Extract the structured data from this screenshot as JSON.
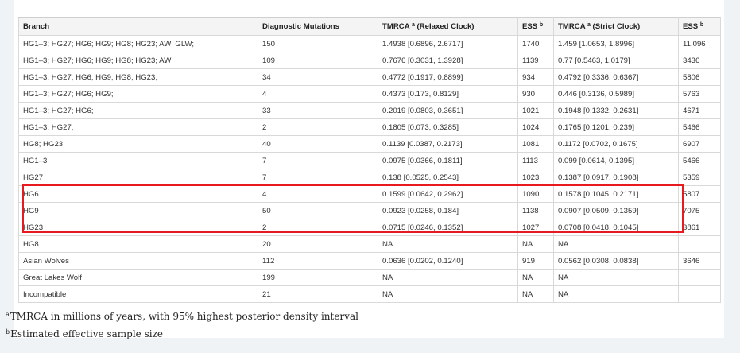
{
  "table": {
    "headers": [
      {
        "text": "Branch",
        "sup": ""
      },
      {
        "text": "Diagnostic Mutations",
        "sup": ""
      },
      {
        "text": "TMRCA ",
        "sup": "a",
        "after": " (Relaxed Clock)"
      },
      {
        "text": "ESS ",
        "sup": "b",
        "after": ""
      },
      {
        "text": "TMRCA ",
        "sup": "a",
        "after": " (Strict Clock)"
      },
      {
        "text": "ESS ",
        "sup": "b",
        "after": ""
      }
    ],
    "rows": [
      [
        "HG1–3; HG27; HG6; HG9; HG8; HG23; AW; GLW;",
        "150",
        "1.4938 [0.6896, 2.6717]",
        "1740",
        "1.459 [1.0653, 1.8996]",
        "11,096"
      ],
      [
        "HG1–3; HG27; HG6; HG9; HG8; HG23; AW;",
        "109",
        "0.7676 [0.3031, 1.3928]",
        "1139",
        "0.77 [0.5463, 1.0179]",
        "3436"
      ],
      [
        "HG1–3; HG27; HG6; HG9; HG8; HG23;",
        "34",
        "0.4772 [0.1917, 0.8899]",
        "934",
        "0.4792 [0.3336, 0.6367]",
        "5806"
      ],
      [
        "HG1–3; HG27; HG6; HG9;",
        "4",
        "0.4373 [0.173, 0.8129]",
        "930",
        "0.446 [0.3136, 0.5989]",
        "5763"
      ],
      [
        "HG1–3; HG27; HG6;",
        "33",
        "0.2019 [0.0803, 0.3651]",
        "1021",
        "0.1948 [0.1332, 0.2631]",
        "4671"
      ],
      [
        "HG1–3; HG27;",
        "2",
        "0.1805 [0.073, 0.3285]",
        "1024",
        "0.1765 [0.1201, 0.239]",
        "5466"
      ],
      [
        "HG8; HG23;",
        "40",
        "0.1139 [0.0387, 0.2173]",
        "1081",
        "0.1172 [0.0702, 0.1675]",
        "6907"
      ],
      [
        "HG1–3",
        "7",
        "0.0975 [0.0366, 0.1811]",
        "1113",
        "0.099 [0.0614, 0.1395]",
        "5466"
      ],
      [
        "HG27",
        "7",
        "0.138 [0.0525, 0.2543]",
        "1023",
        "0.1387 [0.0917, 0.1908]",
        "5359"
      ],
      [
        "HG6",
        "4",
        "0.1599 [0.0642, 0.2962]",
        "1090",
        "0.1578 [0.1045, 0.2171]",
        "5807"
      ],
      [
        "HG9",
        "50",
        "0.0923 [0.0258, 0.184]",
        "1138",
        "0.0907 [0.0509, 0.1359]",
        "7075"
      ],
      [
        "HG23",
        "2",
        "0.0715 [0.0246, 0.1352]",
        "1027",
        "0.0708 [0.0418, 0.1045]",
        "3861"
      ],
      [
        "HG8",
        "20",
        "NA",
        "NA",
        "NA",
        ""
      ],
      [
        "Asian Wolves",
        "112",
        "0.0636 [0.0202, 0.1240]",
        "919",
        "0.0562 [0.0308, 0.0838]",
        "3646"
      ],
      [
        "Great Lakes Wolf",
        "199",
        "NA",
        "NA",
        "NA",
        ""
      ],
      [
        "Incompatible",
        "21",
        "NA",
        "NA",
        "NA",
        ""
      ]
    ]
  },
  "footnotes": [
    {
      "marker": "a",
      "text": "TMRCA in millions of years, with 95% highest posterior density interval"
    },
    {
      "marker": "b",
      "text": "Estimated effective sample size"
    }
  ],
  "colors": {
    "highlight": "#e8191f",
    "header_bg": "#f4f4f4",
    "border": "#d9d9d9"
  }
}
